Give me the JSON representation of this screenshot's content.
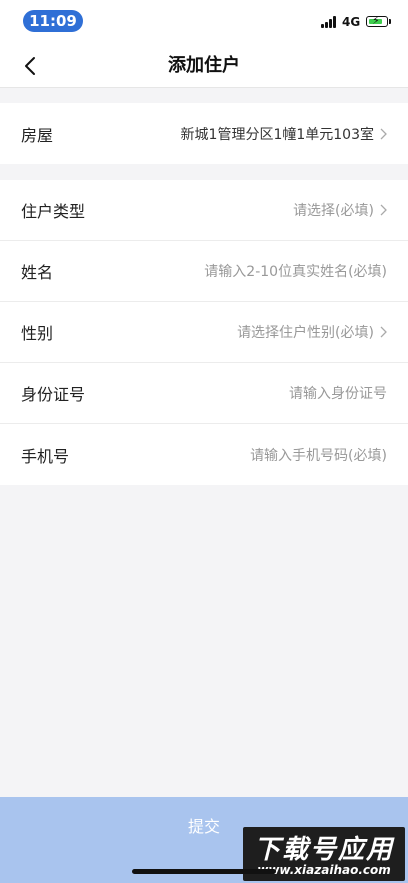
{
  "status": {
    "time": "11:09",
    "network": "4G",
    "battery_color": "#3ecf4e"
  },
  "nav": {
    "title": "添加住户",
    "back_icon": "chevron-left-icon"
  },
  "house": {
    "label": "房屋",
    "value": "新城1管理分区1幢1单元103室"
  },
  "form": {
    "type": {
      "label": "住户类型",
      "placeholder": "请选择(必填)"
    },
    "name": {
      "label": "姓名",
      "placeholder": "请输入2-10位真实姓名(必填)"
    },
    "gender": {
      "label": "性别",
      "placeholder": "请选择住户性别(必填)"
    },
    "id_number": {
      "label": "身份证号",
      "placeholder": "请输入身份证号"
    },
    "phone": {
      "label": "手机号",
      "placeholder": "请输入手机号码(必填)"
    }
  },
  "submit_label": "提交",
  "colors": {
    "accent": "#2f6fd6",
    "submit_bg": "#a9c4ee"
  },
  "watermark": {
    "main": "下载号应用",
    "url": "www.xiazaihao.com"
  }
}
